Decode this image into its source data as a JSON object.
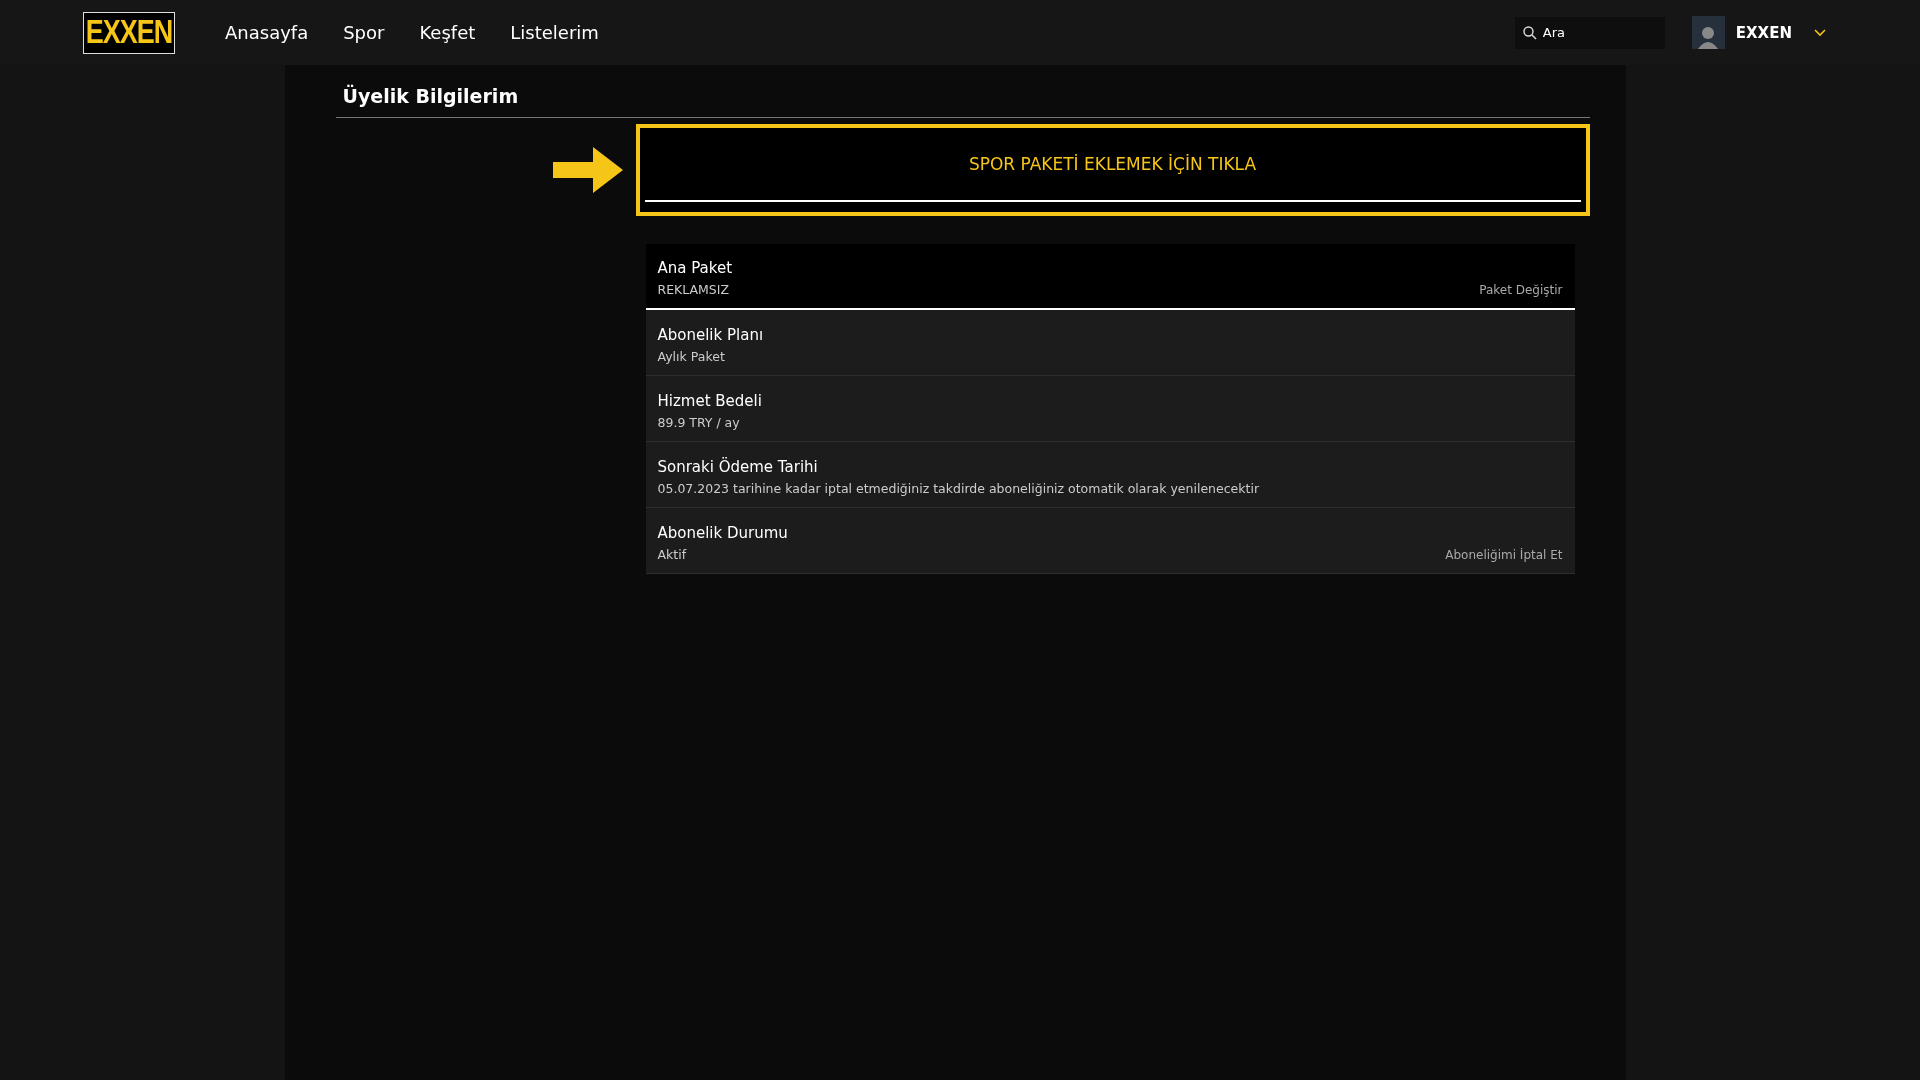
{
  "header": {
    "logo": "EXXEN",
    "nav": [
      {
        "label": "Anasayfa"
      },
      {
        "label": "Spor"
      },
      {
        "label": "Keşfet"
      },
      {
        "label": "Listelerim"
      }
    ],
    "search": {
      "placeholder": "Ara"
    },
    "profile": {
      "name": "EXXEN"
    }
  },
  "page": {
    "title": "Üyelik Bilgilerim",
    "promo": {
      "label": "SPOR PAKETİ EKLEMEK İÇİN TIKLA"
    },
    "rows": [
      {
        "kind": "main",
        "title": "Ana Paket",
        "value": "REKLAMSIZ",
        "action": "Paket Değiştir"
      },
      {
        "kind": "detail",
        "title": "Abonelik Planı",
        "value": "Aylık Paket"
      },
      {
        "kind": "detail",
        "title": "Hizmet Bedeli",
        "value": "89.9 TRY / ay"
      },
      {
        "kind": "detail",
        "title": "Sonraki Ödeme Tarihi",
        "value": "05.07.2023 tarihine kadar iptal etmediğiniz takdirde aboneliğiniz otomatik olarak yenilenecektir"
      },
      {
        "kind": "detail",
        "title": "Abonelik Durumu",
        "value": "Aktif",
        "action": "Aboneliğimi İptal Et"
      }
    ]
  }
}
